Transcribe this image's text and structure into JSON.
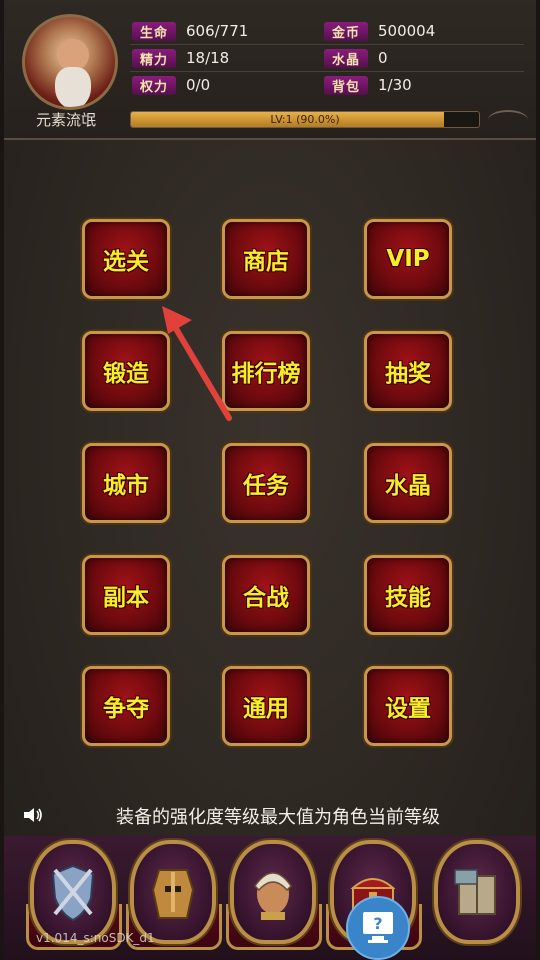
{
  "player": {
    "name": "元素流氓",
    "stats": [
      {
        "label": "生命",
        "value": "606/771"
      },
      {
        "label": "金币",
        "value": "500004"
      },
      {
        "label": "精力",
        "value": "18/18"
      },
      {
        "label": "水晶",
        "value": "0"
      },
      {
        "label": "权力",
        "value": "0/0"
      },
      {
        "label": "背包",
        "value": "1/30"
      }
    ],
    "level_text": "LV:1 (90.0%)",
    "exp_progress": 0.9
  },
  "menu": [
    {
      "label": "选关"
    },
    {
      "label": "商店"
    },
    {
      "label": "VIP"
    },
    {
      "label": "锻造"
    },
    {
      "label": "排行榜"
    },
    {
      "label": "抽奖"
    },
    {
      "label": "城市"
    },
    {
      "label": "任务"
    },
    {
      "label": "水晶"
    },
    {
      "label": "副本"
    },
    {
      "label": "合战"
    },
    {
      "label": "技能"
    },
    {
      "label": "争夺"
    },
    {
      "label": "通用"
    },
    {
      "label": "设置"
    }
  ],
  "tip": "装备的强化度等级最大值为角色当前等级",
  "bottom_nav": [
    {
      "icon": "shield-crossed-swords-icon"
    },
    {
      "icon": "armored-knight-icon"
    },
    {
      "icon": "helmeted-warrior-icon"
    },
    {
      "icon": "treasure-chest-icon"
    },
    {
      "icon": "spellbook-icon"
    }
  ],
  "version": "v1.014_s:noSDK_d1",
  "help_icon": "help-question-icon",
  "colors": {
    "button_text": "#f6ee2a",
    "button_bg": "#8a0e14",
    "button_border": "#c8974c",
    "stat_label_bg": "#7a1a70",
    "exp_fill": "#d9a23c",
    "arrow": "#e0413a",
    "help_button": "#3a84c9"
  }
}
